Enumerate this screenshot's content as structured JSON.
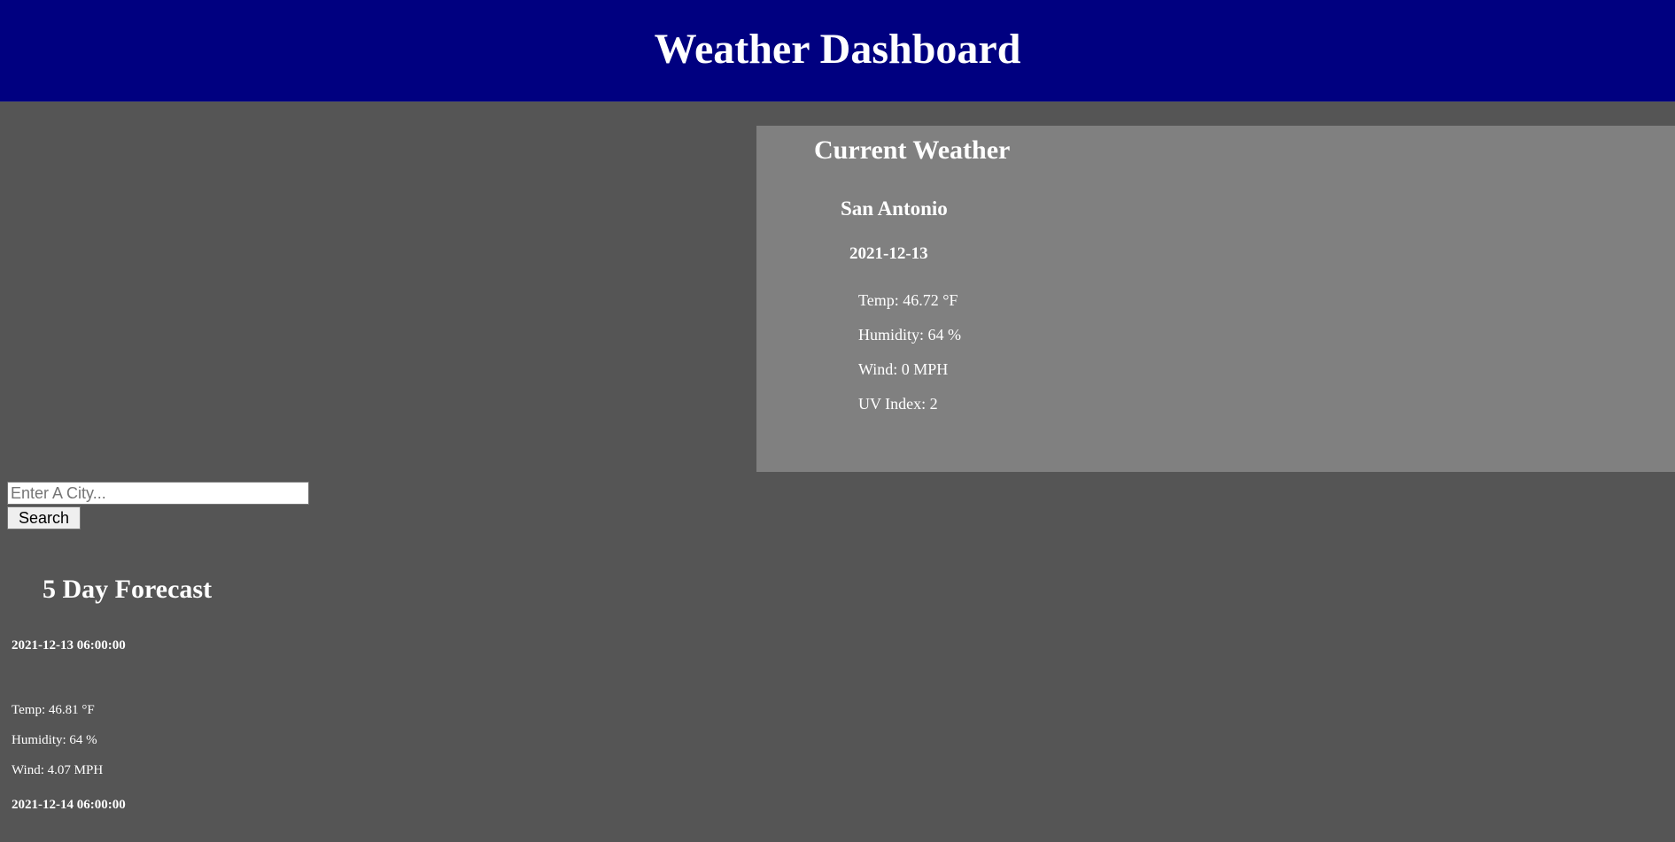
{
  "header": {
    "title": "Weather Dashboard"
  },
  "current": {
    "title": "Current Weather",
    "city": "San Antonio",
    "date": "2021-12-13",
    "temp": "Temp: 46.72 °F",
    "humidity": "Humidity: 64 %",
    "wind": "Wind: 0 MPH",
    "uv": "UV Index: 2"
  },
  "search": {
    "placeholder": "Enter A City...",
    "value": "",
    "button_label": "Search"
  },
  "forecast": {
    "title": "5 Day Forecast",
    "days": [
      {
        "date": "2021-12-13 06:00:00",
        "temp": "Temp: 46.81 °F",
        "humidity": "Humidity: 64 %",
        "wind": "Wind: 4.07 MPH"
      },
      {
        "date": "2021-12-14 06:00:00"
      }
    ]
  },
  "colors": {
    "header_bg": "#000080",
    "page_bg": "#555555",
    "panel_bg": "#808080",
    "text": "#ffffff"
  }
}
